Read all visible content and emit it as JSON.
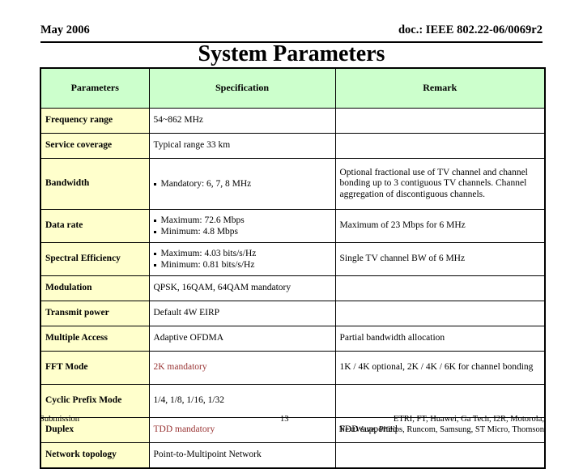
{
  "header": {
    "date": "May 2006",
    "doc": "doc.: IEEE 802.22-06/0069r2"
  },
  "title": "System Parameters",
  "colors": {
    "header_row_bg": "#ccffcc",
    "param_column_bg": "#ffffcc",
    "emphasis_text": "#993333",
    "page_bg": "#ffffff",
    "border": "#000000"
  },
  "table": {
    "columns": [
      "Parameters",
      "Specification",
      "Remark"
    ],
    "rows": [
      {
        "parameter": "Frequency range",
        "spec_text": "54~862 MHz",
        "spec_bullets": [],
        "remark": ""
      },
      {
        "parameter": "Service coverage",
        "spec_text": "Typical range 33 km",
        "spec_bullets": [],
        "remark": ""
      },
      {
        "parameter": "Bandwidth",
        "spec_text": "",
        "spec_bullets": [
          "Mandatory: 6, 7, 8 MHz"
        ],
        "remark": "Optional fractional use of TV channel and channel bonding up to 3 contiguous TV channels. Channel aggregation of discontiguous channels."
      },
      {
        "parameter": "Data rate",
        "spec_text": "",
        "spec_bullets": [
          "Maximum: 72.6 Mbps",
          "Minimum: 4.8 Mbps"
        ],
        "remark": "Maximum of 23 Mbps for 6 MHz"
      },
      {
        "parameter": "Spectral Efficiency",
        "spec_text": "",
        "spec_bullets": [
          "Maximum: 4.03 bits/s/Hz",
          "Minimum: 0.81 bits/s/Hz"
        ],
        "remark": "Single TV channel BW of 6 MHz"
      },
      {
        "parameter": "Modulation",
        "spec_text": "QPSK, 16QAM, 64QAM mandatory",
        "spec_bullets": [],
        "remark": ""
      },
      {
        "parameter": "Transmit power",
        "spec_text": "Default 4W EIRP",
        "spec_bullets": [],
        "remark": ""
      },
      {
        "parameter": "Multiple Access",
        "spec_text": "Adaptive OFDMA",
        "spec_bullets": [],
        "remark": "Partial bandwidth allocation"
      },
      {
        "parameter": "FFT Mode",
        "spec_text": "2K mandatory",
        "spec_bullets": [],
        "remark": "1K / 4K optional, 2K / 4K / 6K for channel bonding"
      },
      {
        "parameter": "Cyclic Prefix Mode",
        "spec_text": "1/4, 1/8, 1/16, 1/32",
        "spec_bullets": [],
        "remark": ""
      },
      {
        "parameter": "Duplex",
        "spec_text": "TDD mandatory",
        "spec_bullets": [],
        "remark": "FDD supported"
      },
      {
        "parameter": "Network topology",
        "spec_text": "Point-to-Multipoint Network",
        "spec_bullets": [],
        "remark": ""
      }
    ]
  },
  "footer": {
    "submission": "Submission",
    "page_number": "13",
    "affiliations_line1": "ETRI, FT, Huawei, Ga Tech, I2R, Motorola,",
    "affiliations_line2": "NextWave, Philips, Runcom, Samsung, ST Micro, Thomson"
  }
}
